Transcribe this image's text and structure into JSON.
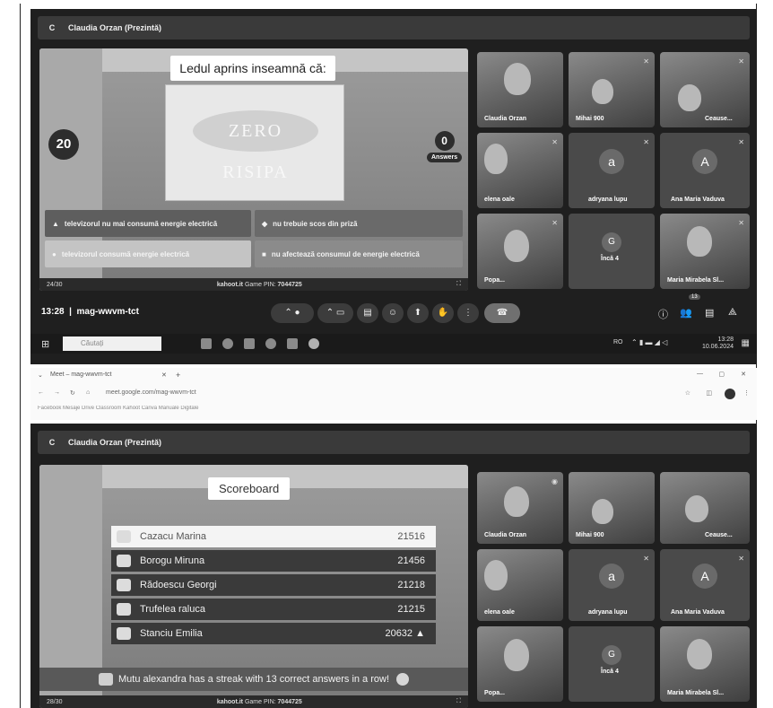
{
  "meet": {
    "presenter_label": "Claudia Orzan (Prezintă)",
    "presenter_initial": "C",
    "meeting_time": "13:28",
    "meeting_code": "mag-wwvm-tct"
  },
  "kahoot": {
    "question": "Ledul aprins inseamnă că:",
    "image_text": "ZERO RISIPA",
    "timer": "20",
    "answers_count": "0",
    "answers_label": "Answers",
    "answers": [
      {
        "symbol": "▲",
        "text": "televizorul nu mai consumă energie electrică"
      },
      {
        "symbol": "◆",
        "text": "nu trebuie scos din priză"
      },
      {
        "symbol": "●",
        "text": "televizorul consumă energie electrică"
      },
      {
        "symbol": "■",
        "text": "nu afectează consumul de energie electrică"
      }
    ],
    "progress": "24/30",
    "footer_brand": "kahoot.it",
    "footer_pin_label": "Game PIN:",
    "footer_pin": "7044725",
    "scoreboard_progress": "28/30",
    "scoreboard_title": "Scoreboard",
    "scoreboard": [
      {
        "name": "Cazacu Marina",
        "score": "21516"
      },
      {
        "name": "Borogu Miruna",
        "score": "21456"
      },
      {
        "name": "Rădoescu Georgi",
        "score": "21218"
      },
      {
        "name": "Trufelea raluca",
        "score": "21215"
      },
      {
        "name": "Stanciu Emilia",
        "score": "20632 ▲"
      }
    ],
    "streak_text": "Mutu alexandra has a streak with 13 correct answers in a row!"
  },
  "participants": [
    {
      "name": "Claudia Orzan",
      "type": "video"
    },
    {
      "name": "Mihai 900",
      "type": "video"
    },
    {
      "name": "Ceause...",
      "type": "video"
    },
    {
      "name": "elena oale",
      "type": "video"
    },
    {
      "name": "adryana lupu",
      "type": "avatar",
      "initial": "a"
    },
    {
      "name": "Ana Maria Vaduva",
      "type": "avatar",
      "initial": "A"
    },
    {
      "name": "Popa...",
      "type": "video"
    },
    {
      "name": "Încă 4",
      "type": "avatar",
      "initial": "G"
    },
    {
      "name": "Maria Mirabela Sl...",
      "type": "video"
    }
  ],
  "controls": {
    "people_count": "13"
  },
  "taskbar": {
    "search_placeholder": "Căutați",
    "time": "13:28",
    "date": "10.06.2024",
    "lang": "RO"
  },
  "browser": {
    "tab_title": "Meet – mag-wwvm-tct",
    "url": "meet.google.com/mag-wwvm-tct",
    "bookmarks": "Facebook   Mesaje   Drive   Classroom   Kahoot   Canva   Manuale Digitale"
  }
}
